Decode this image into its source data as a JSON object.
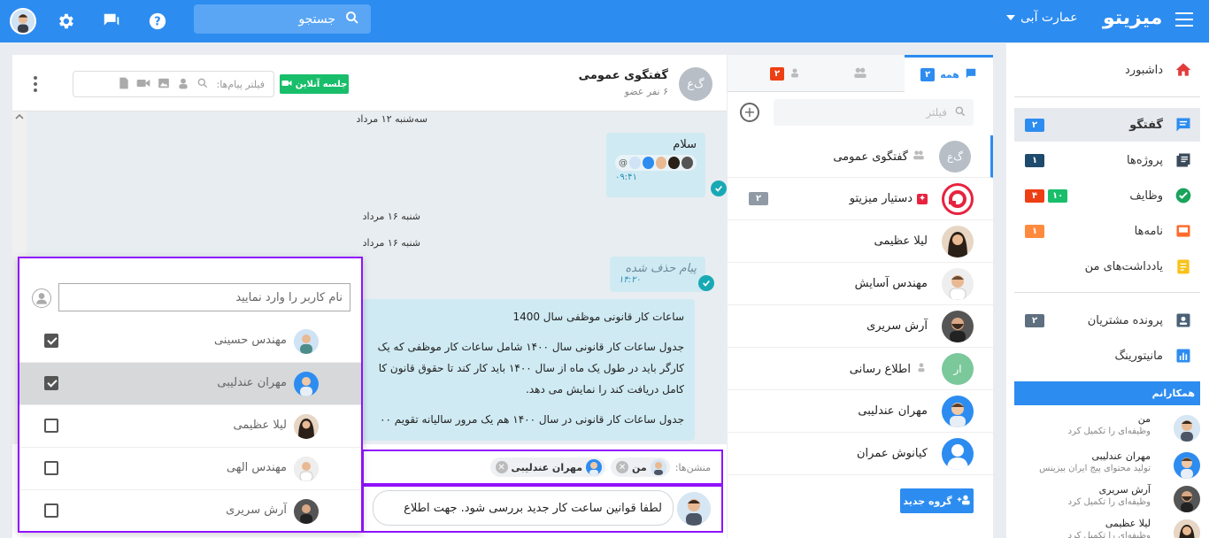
{
  "topbar": {
    "brand": "میزیتو",
    "company": "عمارت آبی",
    "search_placeholder": "جستجو"
  },
  "nav": {
    "items": [
      {
        "label": "داشبورد",
        "icon": "home-icon"
      },
      {
        "label": "گفتگو",
        "icon": "chat-icon",
        "badges": [
          "۲"
        ]
      },
      {
        "label": "پروژه‌ها",
        "icon": "projects-icon",
        "badges": [
          "۱"
        ]
      },
      {
        "label": "وظایف",
        "icon": "tasks-icon",
        "badges": [
          "۱۰",
          "۴"
        ]
      },
      {
        "label": "نامه‌ها",
        "icon": "letters-icon",
        "badges": [
          "۱"
        ]
      },
      {
        "label": "یادداشت‌های من",
        "icon": "notes-icon"
      },
      {
        "label": "پرونده مشتریان",
        "icon": "customers-icon",
        "badges": [
          "۲"
        ]
      },
      {
        "label": "مانیتورینگ",
        "icon": "monitoring-icon"
      }
    ],
    "team_header": "همکارانم",
    "colleagues": [
      {
        "name": "من",
        "status": "وظیفه‌ای را تکمیل کرد"
      },
      {
        "name": "مهران عندلیبی",
        "status": "تولید محتوای پیج ایران بیزینس"
      },
      {
        "name": "آرش سریری",
        "status": "وظیفه‌ای را تکمیل کرد"
      },
      {
        "name": "لیلا عظیمی",
        "status": "وظیفه‌ای را تکمیل کرد"
      }
    ]
  },
  "convlist": {
    "tab_all": "همه",
    "tab_all_badge": "۲",
    "tab_private_badge": "۲",
    "filter_placeholder": "فیلتر",
    "items": [
      {
        "name": "گفتگوی عمومی",
        "avatar_text": "گ‌ع"
      },
      {
        "name": "دستیار میزیتو",
        "count": "۲"
      },
      {
        "name": "لیلا عظیمی"
      },
      {
        "name": "مهندس آسایش"
      },
      {
        "name": "آرش سریری"
      },
      {
        "name": "اطلاع رسانی",
        "avatar_text": "ار"
      },
      {
        "name": "مهران عندلیبی"
      },
      {
        "name": "کیانوش عمران"
      }
    ],
    "new_group": "گروه جدید"
  },
  "chat": {
    "avatar_text": "گ‌ع",
    "title": "گفتگوی عمومی",
    "subtitle": "۶ نفر عضو",
    "online_button": "جلسه آنلاین",
    "msg_filter_placeholder": "فیلتر پیام‌ها:",
    "dates": [
      "سه‌شنبه ۱۲ مرداد",
      "شنبه ۱۶ مرداد",
      "شنبه ۱۶ مرداد"
    ],
    "msg1": {
      "text": "سلام",
      "time": "۰۹:۴۱"
    },
    "msg2": {
      "text": "پیام حذف شده",
      "time": "۱۴:۲۰"
    },
    "msg3": {
      "title": "ساعات کار قانونی موظفی سال 1400",
      "line1": "جدول ساعات کار قانونی سال ۱۴۰۰ شامل ساعات کار موظفی که یک",
      "line2": "کارگر باید در طول یک ماه از سال ۱۴۰۰ باید کار کند تا حقوق قانون کا",
      "line3": "کامل دریافت کند را نمایش می دهد.",
      "line4": "جدول ساعات کار قانونی در سال ۱۴۰۰ هم یک مرور سالیانه تقویم ۰۰"
    },
    "mentions_label": "منشن‌ها:",
    "mention_chips": [
      "من",
      "مهران عندلیبی"
    ],
    "composer_text": "لطفا قوانین ساعت کار جدید بررسی شود. جهت اطلاع"
  },
  "popup": {
    "input_placeholder": "نام کاربر را وارد نمایید",
    "users": [
      {
        "name": "مهندس حسینی",
        "checked": true
      },
      {
        "name": "مهران عندلیبی",
        "checked": true
      },
      {
        "name": "لیلا عظیمی",
        "checked": false
      },
      {
        "name": "مهندس الهی",
        "checked": false
      },
      {
        "name": "آرش سریری",
        "checked": false
      }
    ]
  },
  "colors": {
    "primary": "#2d8cf0",
    "green": "#19be6b",
    "highlight": "#9012fe",
    "bubble": "#cfeaf3"
  }
}
